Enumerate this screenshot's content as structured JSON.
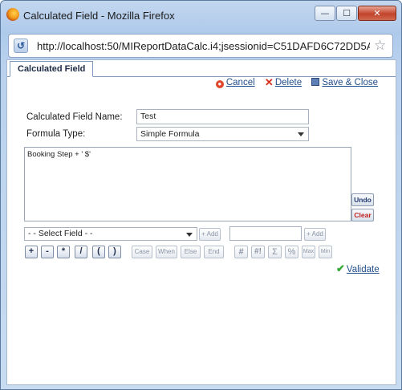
{
  "window": {
    "title": "Calculated Field - Mozilla Firefox",
    "min_glyph": "—",
    "max_glyph": "☐",
    "close_glyph": "✕"
  },
  "browser": {
    "url": "http://localhost:50/MIReportDataCalc.i4;jsessionid=C51DAFD6C72DD5A75218I",
    "site_icon": "site-identity-icon",
    "bookmark_icon": "star-icon"
  },
  "tabs": [
    {
      "label": "Calculated Field",
      "active": true
    }
  ],
  "actions": {
    "cancel": "Cancel",
    "delete": "Delete",
    "save_close": "Save & Close"
  },
  "form": {
    "name_label": "Calculated Field Name:",
    "name_value": "Test",
    "formula_type_label": "Formula Type:",
    "formula_type_value": "Simple Formula",
    "formula_text": "Booking Step + ' $'"
  },
  "side_buttons": {
    "undo": "Undo",
    "clear": "Clear"
  },
  "field_row": {
    "select_field": "- - Select Field - -",
    "add_field": "+ Add",
    "add_value": "+ Add",
    "value_input": ""
  },
  "operators": [
    "+",
    "-",
    "*",
    "/",
    "(",
    ")"
  ],
  "keywords": [
    "Case",
    "When",
    "Else",
    "End"
  ],
  "functions": [
    "#",
    "#!",
    "Σ",
    "%",
    "Max",
    "Min"
  ],
  "validate_label": "Validate",
  "colors": {
    "link": "#1f4e8c",
    "clear_text": "#c12121",
    "validate_check": "#36a836"
  }
}
